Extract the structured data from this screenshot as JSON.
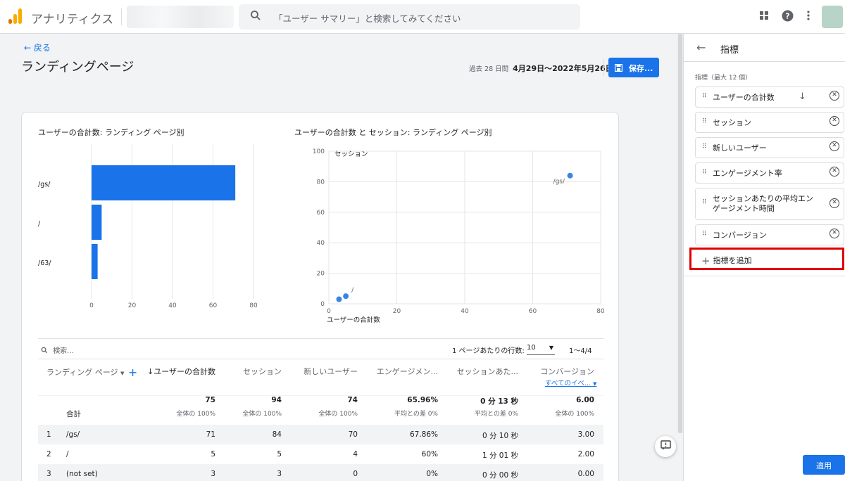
{
  "app": {
    "name": "アナリティクス",
    "search_placeholder": "「ユーザー サマリー」と検索してみてください"
  },
  "page": {
    "back_label": "戻る",
    "title": "ランディングページ",
    "date_period": "過去 28 日間",
    "date_range": "4月29日～2022年5月26日",
    "save_label": "保存..."
  },
  "bar_chart": {
    "title": "ユーザーの合計数: ランディング ページ別"
  },
  "scatter_chart": {
    "title": "ユーザーの合計数 と セッション: ランディング ページ別",
    "ylabel": "セッション",
    "xlabel": "ユーザーの合計数"
  },
  "chart_data": [
    {
      "type": "bar",
      "orientation": "horizontal",
      "title": "ユーザーの合計数: ランディング ページ別",
      "categories": [
        "/gs/",
        "/",
        "/63/"
      ],
      "values": [
        71,
        5,
        3
      ],
      "xlim": [
        0,
        80
      ],
      "xticks": [
        0,
        20,
        40,
        60,
        80
      ]
    },
    {
      "type": "scatter",
      "title": "ユーザーの合計数 と セッション: ランディング ページ別",
      "xlabel": "ユーザーの合計数",
      "ylabel": "セッション",
      "points": [
        {
          "label": "/gs/",
          "x": 71,
          "y": 84
        },
        {
          "label": "/",
          "x": 5,
          "y": 5
        },
        {
          "label": "",
          "x": 3,
          "y": 3
        }
      ],
      "xlim": [
        0,
        80
      ],
      "ylim": [
        0,
        100
      ],
      "xticks": [
        0,
        20,
        40,
        60,
        80
      ],
      "yticks": [
        0,
        20,
        40,
        60,
        80,
        100
      ]
    }
  ],
  "table_tools": {
    "search_placeholder": "検索...",
    "rows_per_page_label": "1 ページあたりの行数:",
    "rows_per_page_value": "10",
    "pagination": "1～4/4"
  },
  "table": {
    "dimension_header": "ランディング ページ",
    "columns": [
      "↓ユーザーの合計数",
      "セッション",
      "新しいユーザー",
      "エンゲージメン...",
      "セッションあた...",
      "コンバージョン"
    ],
    "conversion_sub": "すべてのイベ...",
    "total_label": "合計",
    "totals": [
      "75",
      "94",
      "74",
      "65.96%",
      "0 分 13 秒",
      "6.00"
    ],
    "total_subs": [
      "全体の 100%",
      "全体の 100%",
      "全体の 100%",
      "平均との差 0%",
      "平均との差 0%",
      "全体の 100%"
    ],
    "rows": [
      {
        "idx": "1",
        "page": "/gs/",
        "cells": [
          "71",
          "84",
          "70",
          "67.86%",
          "0 分 10 秒",
          "3.00"
        ]
      },
      {
        "idx": "2",
        "page": "/",
        "cells": [
          "5",
          "5",
          "4",
          "60%",
          "1 分 01 秒",
          "2.00"
        ]
      },
      {
        "idx": "3",
        "page": "(not set)",
        "cells": [
          "3",
          "3",
          "0",
          "0%",
          "0 分 00 秒",
          "0.00"
        ]
      }
    ]
  },
  "side_panel": {
    "title": "指標",
    "metrics_label": "指標（最大 12 個）",
    "metrics": [
      "ユーザーの合計数",
      "セッション",
      "新しいユーザー",
      "エンゲージメント率",
      "セッションあたりの平均エンゲージメント時間",
      "コンバージョン"
    ],
    "add_label": "指標を追加",
    "apply_label": "適用"
  }
}
